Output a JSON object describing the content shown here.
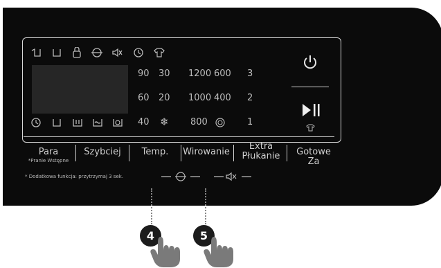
{
  "status_icons": [
    "prewash-icon",
    "wash-icon",
    "door-lock-icon",
    "spin-icon",
    "sound-off-icon",
    "delay-timer-icon",
    "easy-iron-icon"
  ],
  "bottom_icons": [
    "clock-icon",
    "wash-icon",
    "main-wash-icon",
    "rinse-icon",
    "spin-drain-icon"
  ],
  "temps_col1": [
    "90",
    "60",
    "40"
  ],
  "temps_col2": [
    "30",
    "20"
  ],
  "cold_icon": "snowflake-icon",
  "spin_col1": [
    "1200",
    "1000",
    "800"
  ],
  "spin_col2": [
    "600",
    "400"
  ],
  "no_spin_icon": "no-spin-icon",
  "rinse_count": [
    "3",
    "2",
    "1"
  ],
  "buttons": {
    "para": "Para",
    "para_sub": "*Pranie Wstępne",
    "szybciej": "Szybciej",
    "temp": "Temp.",
    "wirowanie": "Wirowanie",
    "extra_line1": "Extra",
    "extra_line2": "Płukanie",
    "gotowe": "Gotowe Za"
  },
  "footnote_star": "*",
  "footnote": "Dodatkowa funkcja: przytrzymaj 3 sek.",
  "markers": {
    "m4": "4",
    "m5": "5"
  },
  "colors": {
    "panel": "#0b0b0b",
    "text": "#d2d2d2",
    "hand": "#7a7a7a"
  }
}
